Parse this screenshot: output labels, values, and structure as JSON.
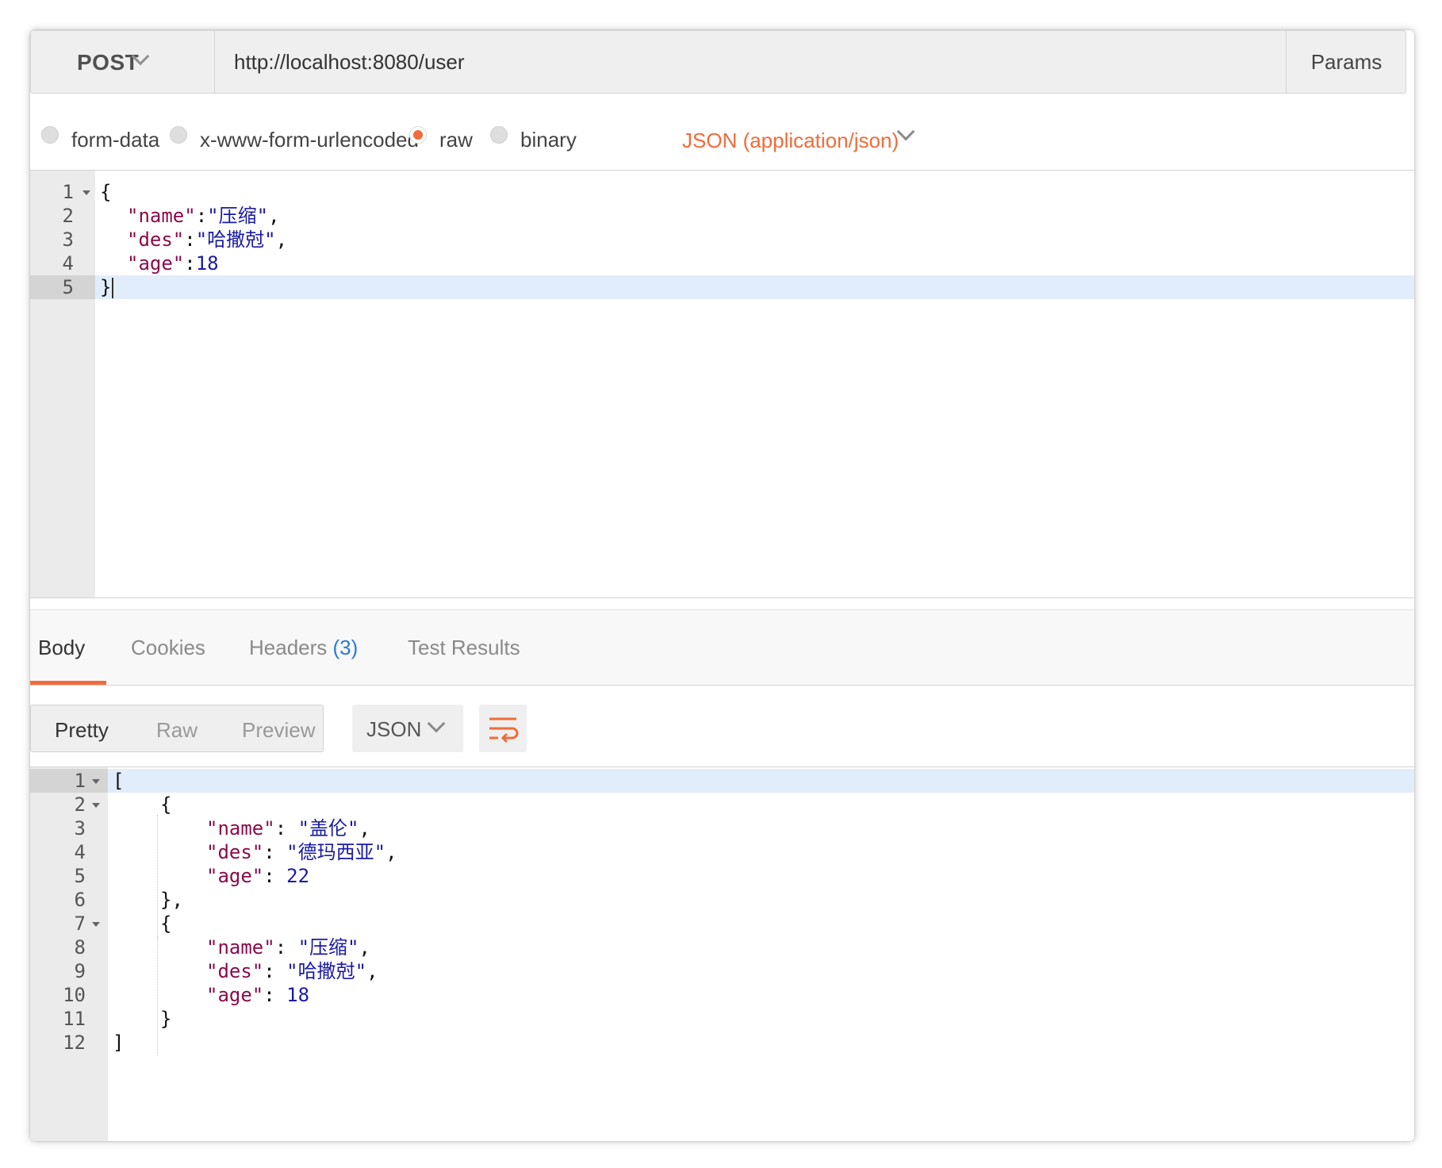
{
  "request": {
    "method": "POST",
    "url": "http://localhost:8080/user",
    "params_label": "Params"
  },
  "body_types": [
    {
      "label": "form-data",
      "selected": false
    },
    {
      "label": "x-www-form-urlencoded",
      "selected": false
    },
    {
      "label": "raw",
      "selected": true
    },
    {
      "label": "binary",
      "selected": false
    }
  ],
  "content_type": "JSON (application/json)",
  "request_body": {
    "line_numbers": [
      "1",
      "2",
      "3",
      "4",
      "5"
    ],
    "open_brace": "{",
    "name_key": "\"name\"",
    "name_value": "\"压缩\"",
    "des_key": "\"des\"",
    "des_value": "\"哈撒尅\"",
    "age_key": "\"age\"",
    "age_value": "18",
    "close_brace": "}"
  },
  "response_tabs": {
    "body": "Body",
    "cookies": "Cookies",
    "headers": "Headers",
    "headers_count": "(3)",
    "tests": "Test Results"
  },
  "view_modes": {
    "pretty": "Pretty",
    "raw": "Raw",
    "preview": "Preview"
  },
  "format": "JSON",
  "response_body": {
    "line_numbers": [
      "1",
      "2",
      "3",
      "4",
      "5",
      "6",
      "7",
      "8",
      "9",
      "10",
      "11",
      "12"
    ],
    "items": [
      {
        "name": "\"盖伦\"",
        "des": "\"德玛西亚\"",
        "age": "22"
      },
      {
        "name": "\"压缩\"",
        "des": "\"哈撒尅\"",
        "age": "18"
      }
    ],
    "name_key": "\"name\"",
    "des_key": "\"des\"",
    "age_key": "\"age\""
  },
  "colors": {
    "accent": "#f26b3a",
    "key": "#8b0b4a",
    "string": "#1a1aa6",
    "link": "#2a7ad5"
  }
}
